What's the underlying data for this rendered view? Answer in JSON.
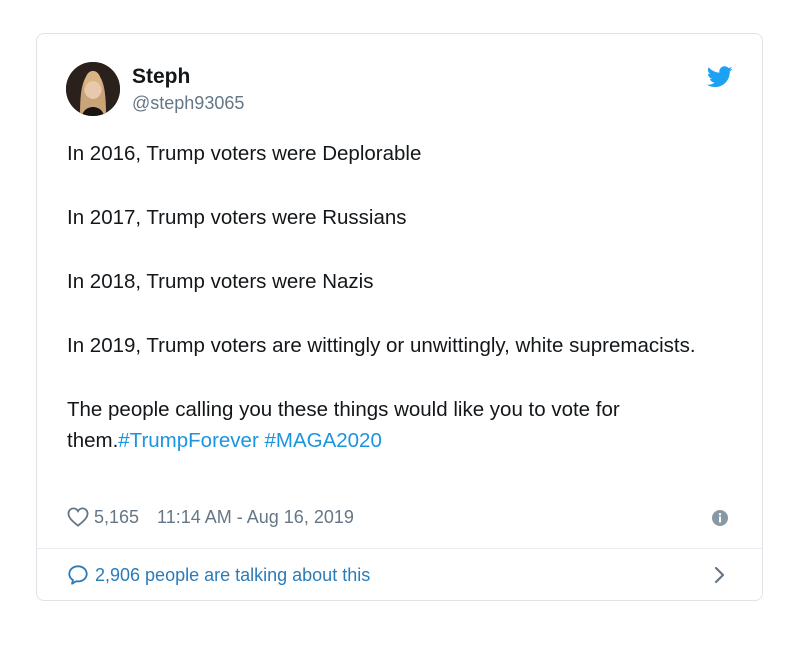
{
  "tweet": {
    "author_name": "Steph",
    "author_handle": "@steph93065",
    "paragraphs": [
      "In 2016, Trump voters were Deplorable",
      "In 2017, Trump voters were Russians",
      "In 2018, Trump voters were Nazis",
      "In 2019, Trump voters are wittingly or unwittingly, white supremacists."
    ],
    "closing_text": "The people calling you these things would like you to vote for them.",
    "hashtags": [
      "#TrumpForever",
      "#MAGA2020"
    ],
    "likes": "5,165",
    "timestamp": "11:14 AM - Aug 16, 2019",
    "talking": "2,906 people are talking about this"
  },
  "icons": {
    "logo": "twitter-bird-icon",
    "like": "heart-icon",
    "info": "info-icon",
    "reply": "speech-bubble-icon",
    "more": "chevron-right-icon"
  },
  "colors": {
    "text": "#14171a",
    "secondary": "#657786",
    "link": "#1b95e0",
    "brand": "#1da1f2"
  }
}
